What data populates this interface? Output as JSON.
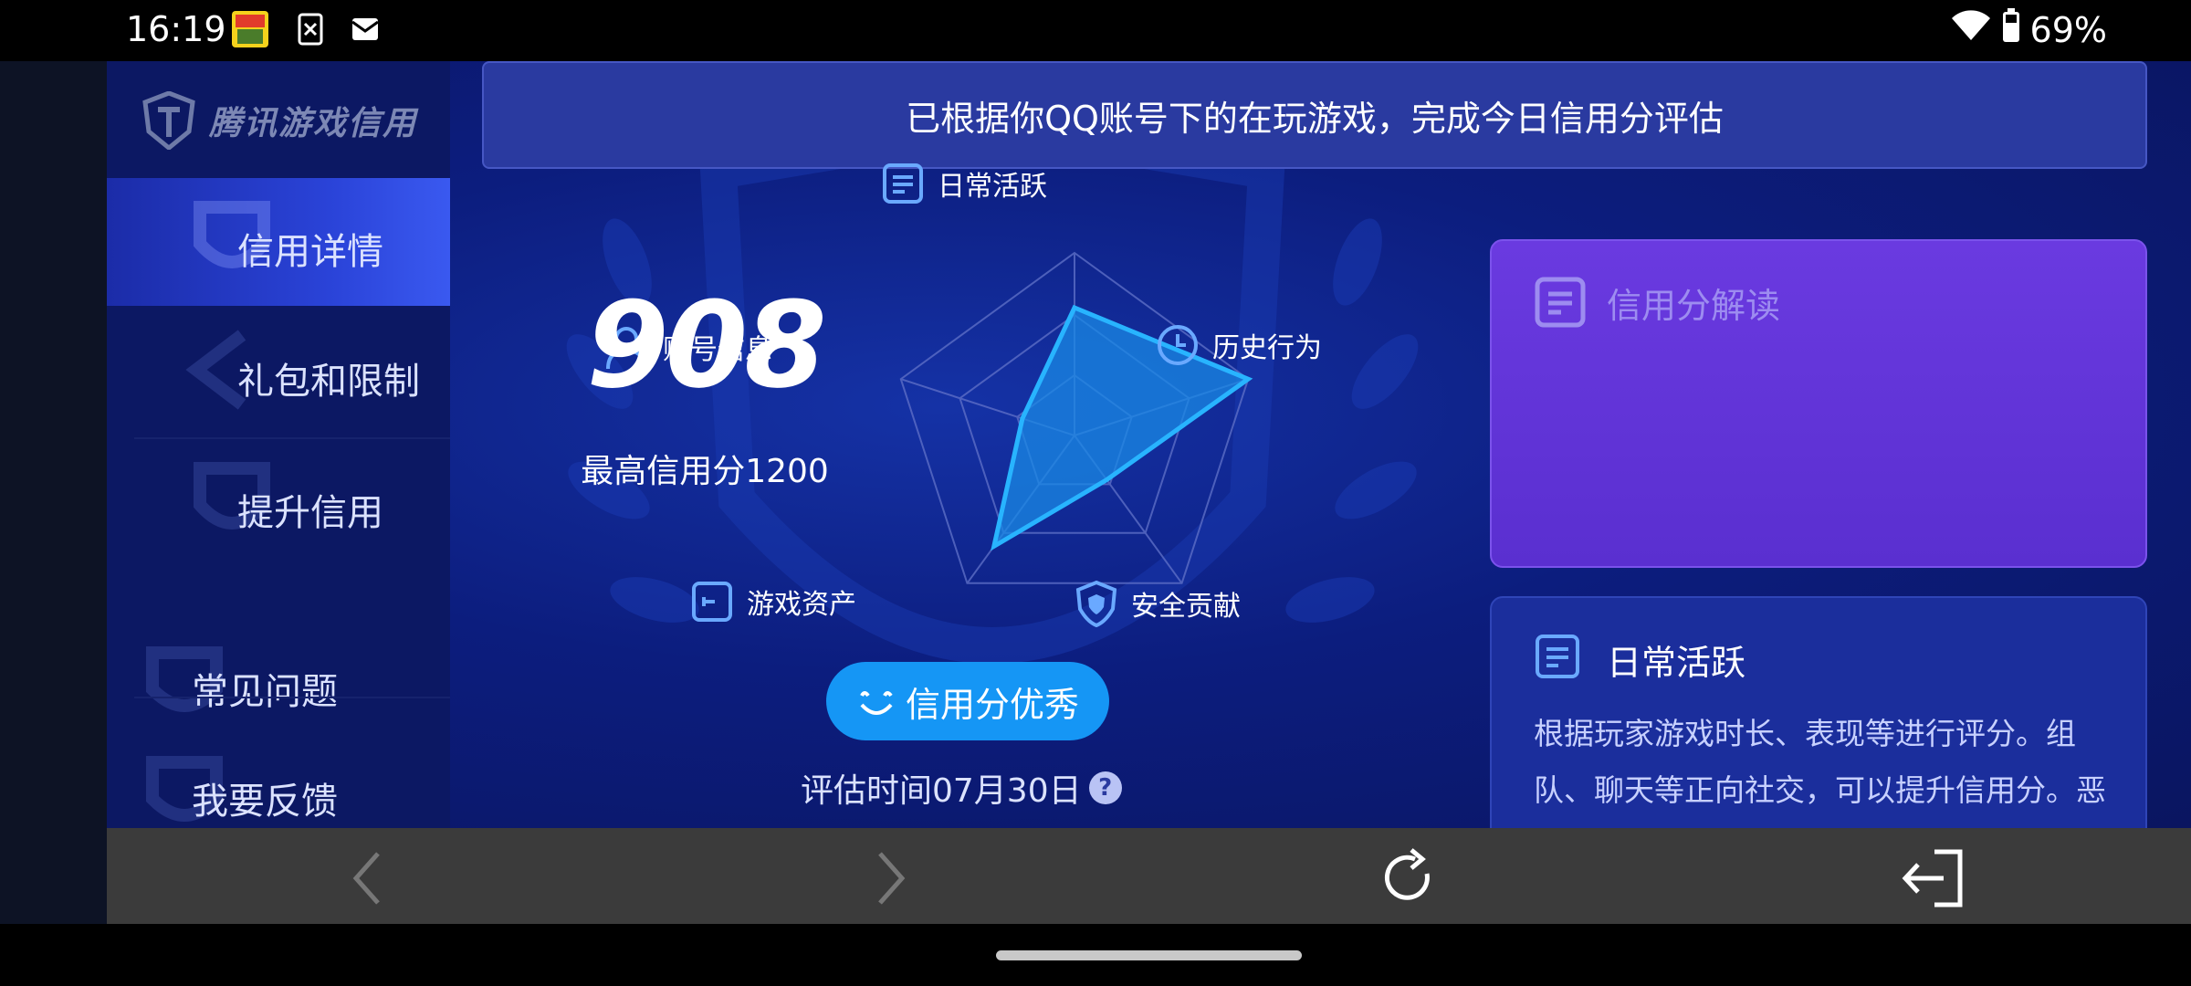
{
  "status_bar": {
    "time": "16:19",
    "notification_icons": [
      "game-app-icon",
      "close-box-icon",
      "mail-icon"
    ],
    "wifi_icon": "wifi-icon",
    "battery_icon": "battery-icon",
    "battery_percent": "69%"
  },
  "sidebar": {
    "logo_text": "腾讯游戏信用",
    "items": [
      {
        "label": "信用详情",
        "active": true
      },
      {
        "label": "礼包和限制",
        "active": false
      },
      {
        "label": "提升信用",
        "active": false
      },
      {
        "label": "常见问题",
        "active": false
      },
      {
        "label": "我要反馈",
        "active": false
      }
    ]
  },
  "banner": {
    "text": "已根据你QQ账号下的在玩游戏，完成今日信用分评估"
  },
  "credit": {
    "score": "908",
    "max_label": "最高信用分1200",
    "rating_button": "信用分优秀",
    "eval_time": "评估时间07月30日",
    "help_symbol": "?"
  },
  "radar": {
    "axes": [
      {
        "label": "日常活跃",
        "icon": "document-icon",
        "value": 0.7
      },
      {
        "label": "历史行为",
        "icon": "clock-icon",
        "value": 1.0
      },
      {
        "label": "安全贡献",
        "icon": "shield-icon",
        "value": 0.3
      },
      {
        "label": "游戏资产",
        "icon": "wallet-icon",
        "value": 0.75
      },
      {
        "label": "账号信息",
        "icon": "user-icon",
        "value": 0.3
      }
    ]
  },
  "cards": {
    "interpretation": {
      "title": "信用分解读"
    },
    "detail": {
      "title": "日常活跃",
      "body": "根据玩家游戏时长、表现等进行评分。组队、聊天等正向社交，可以提升信用分。恶"
    }
  },
  "toolbar": {
    "back_icon": "chevron-left-icon",
    "forward_icon": "chevron-right-icon",
    "refresh_icon": "refresh-icon",
    "exit_icon": "exit-icon"
  },
  "colors": {
    "app_background": "#0c1d7e",
    "sidebar": "#0c1863",
    "accent_blue": "#1596f5",
    "radar_fill": "#1a8ae6",
    "card_purple": "#6a3ae0"
  }
}
